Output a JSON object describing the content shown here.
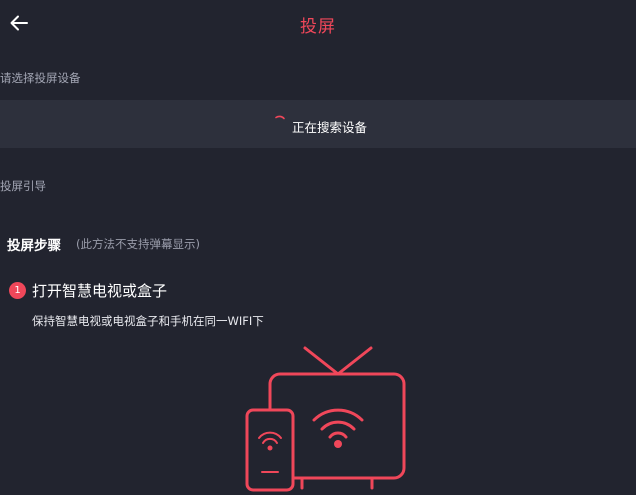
{
  "header": {
    "title": "投屏"
  },
  "device_section": {
    "label": "请选择投屏设备",
    "status": "正在搜索设备"
  },
  "guide_section": {
    "label": "投屏引导"
  },
  "steps": {
    "title": "投屏步骤",
    "note": "(此方法不支持弹幕显示)",
    "items": [
      {
        "number": "1",
        "title": "打开智慧电视或盒子",
        "desc": "保持智慧电视或电视盒子和手机在同一WIFI下"
      }
    ]
  },
  "colors": {
    "accent": "#f0475a",
    "background": "#22242f",
    "bar": "#2d303c"
  },
  "icons": [
    "back-arrow-icon",
    "loading-spinner-icon",
    "tv-phone-wifi-illustration"
  ]
}
